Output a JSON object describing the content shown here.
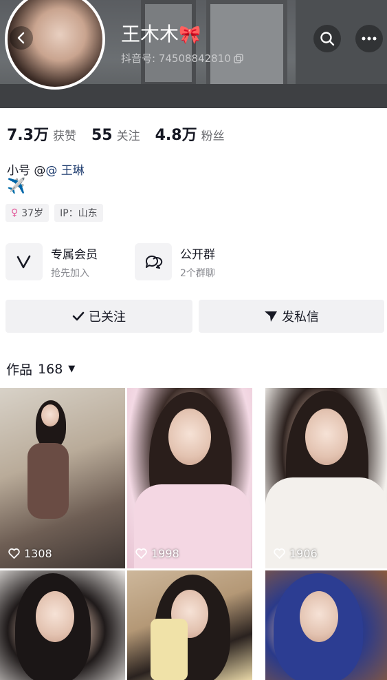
{
  "header": {
    "name": "王木木",
    "name_emoji": "🎀",
    "id_label": "抖音号: 74508842810"
  },
  "stats": [
    {
      "value": "7.3万",
      "label": "获赞"
    },
    {
      "value": "55",
      "label": "关注"
    },
    {
      "value": "4.8万",
      "label": "粉丝"
    }
  ],
  "bio": {
    "line1_prefix": "小号 @",
    "line1_mention": "@ 王琳",
    "emoji": "✈️"
  },
  "tags": {
    "age": "37岁",
    "ip": "IP：山东"
  },
  "features": [
    {
      "title": "专属会员",
      "subtitle": "抢先加入"
    },
    {
      "title": "公开群",
      "subtitle": "2个群聊"
    }
  ],
  "actions": {
    "follow": "已关注",
    "message": "发私信"
  },
  "works": {
    "label": "作品",
    "count": "168"
  },
  "videos": [
    {
      "likes": "1308"
    },
    {
      "likes": "1998"
    },
    {
      "likes": "1906"
    },
    {
      "likes": ""
    },
    {
      "likes": ""
    },
    {
      "likes": ""
    }
  ]
}
